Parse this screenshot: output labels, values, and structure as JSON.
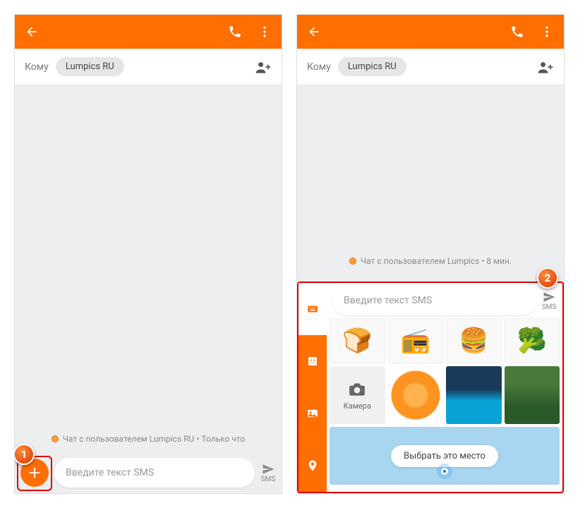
{
  "recipient": {
    "label": "Кому",
    "chip": "Lumpics RU"
  },
  "timestamps": {
    "screen_a": "Чат с пользователем Lumpics RU • Только что",
    "screen_b": "Чат с пользователем Lumpics • 8 мин."
  },
  "compose": {
    "placeholder": "Введите текст SMS",
    "send_type": "SMS"
  },
  "attach": {
    "camera_label": "Камера",
    "location_button": "Выбрать это место"
  },
  "markers": {
    "one": "1",
    "two": "2"
  }
}
